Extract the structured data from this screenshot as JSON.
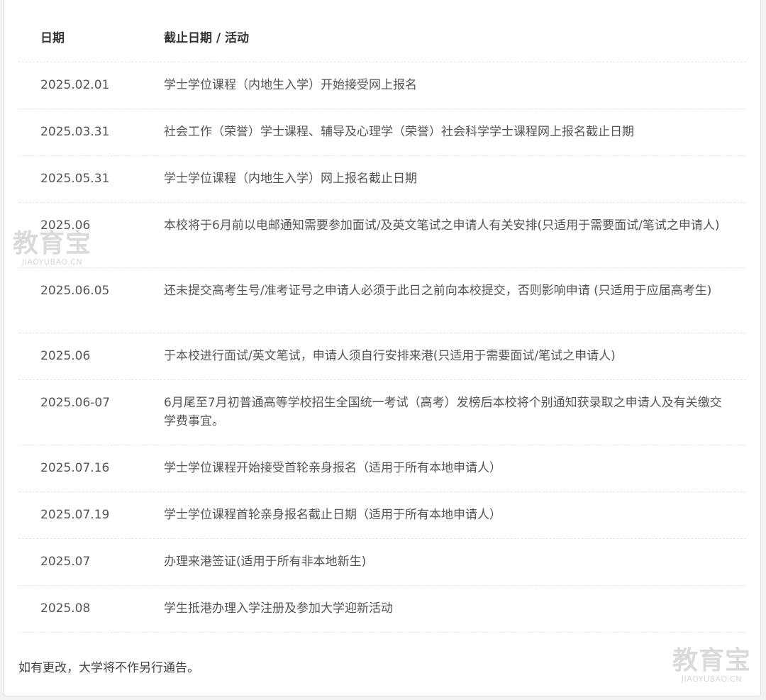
{
  "table": {
    "header": {
      "date": "日期",
      "activity": "截止日期 / 活动"
    },
    "rows": [
      {
        "date": "2025.02.01",
        "activity": "学士学位课程（内地生入学）开始接受网上报名"
      },
      {
        "date": "2025.03.31",
        "activity": "社会工作（荣誉）学士课程、辅导及心理学（荣誉）社会科学学士课程网上报名截止日期"
      },
      {
        "date": "2025.05.31",
        "activity": "学士学位课程（内地生入学）网上报名截止日期"
      },
      {
        "date": "2025.06",
        "activity": "本校将于6月前以电邮通知需要参加面试/及英文笔试之申请人有关安排(只适用于需要面试/笔试之申请人)"
      },
      {
        "date": "2025.06.05",
        "activity": "还未提交高考生号/准考证号之申请人必须于此日之前向本校提交，否则影响申请 (只适用于应届高考生)"
      },
      {
        "date": "2025.06",
        "activity": "于本校进行面试/英文笔试，申请人须自行安排来港(只适用于需要面试/笔试之申请人)"
      },
      {
        "date": "2025.06-07",
        "activity": "6月尾至7月初普通高等学校招生全国统一考试（高考）发榜后本校将个别通知获录取之申请人及有关缴交学费事宜。"
      },
      {
        "date": "2025.07.16",
        "activity": "学士学位课程开始接受首轮亲身报名（适用于所有本地申请人）"
      },
      {
        "date": "2025.07.19",
        "activity": "学士学位课程首轮亲身报名截止日期（适用于所有本地申请人）"
      },
      {
        "date": "2025.07",
        "activity": "办理来港签证(适用于所有非本地新生)"
      },
      {
        "date": "2025.08",
        "activity": "学生抵港办理入学注册及参加大学迎新活动"
      }
    ]
  },
  "note": "如有更改，大学将不作另行通告。",
  "watermark": {
    "brand": "教育宝",
    "domain": "JIAOYUBAO.CN"
  }
}
